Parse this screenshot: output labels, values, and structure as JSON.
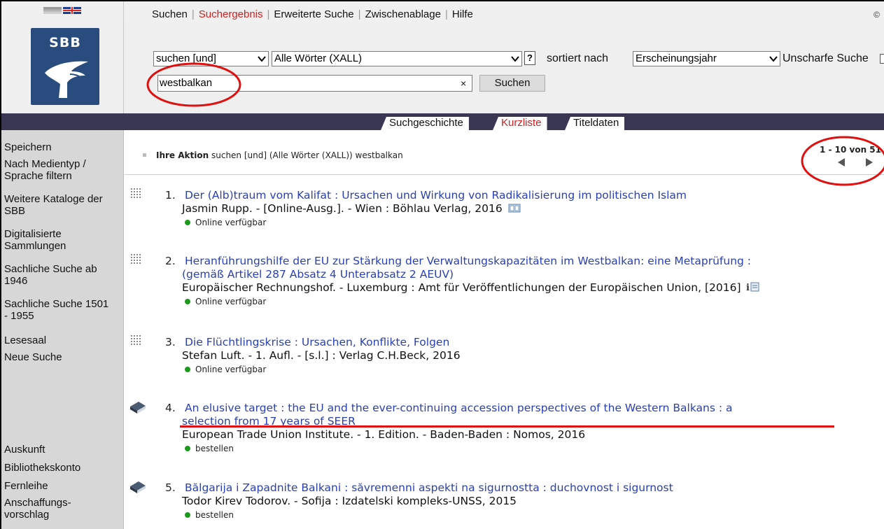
{
  "topnav": {
    "items": [
      {
        "label": "Suchen",
        "active": false
      },
      {
        "label": "Suchergebnis",
        "active": true
      },
      {
        "label": "Erweiterte Suche",
        "active": false
      },
      {
        "label": "Zwischenablage",
        "active": false
      },
      {
        "label": "Hilfe",
        "active": false
      }
    ],
    "copyright": "©"
  },
  "logo": {
    "text": "SBB"
  },
  "search": {
    "operator": "suchen [und]",
    "field": "Alle Wörter (XALL)",
    "help": "?",
    "sort_label": "sortiert nach",
    "sort_value": "Erscheinungsjahr",
    "fuzzy_label": "Unscharfe Suche",
    "query": "westbalkan",
    "clear": "×",
    "button": "Suchen"
  },
  "tabs": [
    {
      "label": "Suchgeschichte",
      "active": false
    },
    {
      "label": "Kurzliste",
      "active": true
    },
    {
      "label": "Titeldaten",
      "active": false
    }
  ],
  "sidebar": {
    "items": [
      "Speichern",
      "Nach Medientyp / Sprache filtern",
      "Weitere Kataloge der SBB",
      "Digitalisierte Sammlungen",
      "Sachliche Suche ab 1946",
      "Sachliche Suche 1501 - 1955",
      "Lesesaal",
      "Neue Suche"
    ],
    "bottom_items": [
      "Auskunft",
      "Bibliothekskonto",
      "Fernleihe",
      "Anschaffungs- vorschlag"
    ]
  },
  "action": {
    "label": "Ihre Aktion",
    "text": "suchen [und] (Alle Wörter (XALL)) westbalkan"
  },
  "paging": {
    "range": "1 - 10 von 51"
  },
  "records": [
    {
      "num": "1.",
      "title_lines": [
        "Der (Alb)traum vom Kalifat : Ursachen und Wirkung von Radikalisierung im politischen Islam"
      ],
      "author": "Jasmin Rupp. - [Online-Ausg.]. - Wien : Böhlau Verlag, 2016",
      "status": "Online verfügbar",
      "icon": "online-resource-icon"
    },
    {
      "num": "2.",
      "title_lines": [
        "Heranführungshilfe der EU zur Stärkung der Verwaltungskapazitäten im Westbalkan: eine Metaprüfung :",
        "(gemäß Artikel 287 Absatz 4 Unterabsatz 2 AEUV)"
      ],
      "author": "Europäischer Rechnungshof. - Luxemburg : Amt für Veröffentlichungen der Europäischen Union, [2016]",
      "status": "Online verfügbar",
      "icon": "online-resource-icon"
    },
    {
      "num": "3.",
      "title_lines": [
        "Die Flüchtlingskrise : Ursachen, Konflikte, Folgen"
      ],
      "author": "Stefan Luft. - 1. Aufl. - [s.l.] : Verlag C.H.Beck, 2016",
      "status": "Online verfügbar",
      "icon": "online-resource-icon"
    },
    {
      "num": "4.",
      "title_lines": [
        "An elusive target : the EU and the ever-continuing accession perspectives of the Western Balkans : a",
        "selection from 17 years of SEER"
      ],
      "author": "European Trade Union Institute. - 1. Edition. - Baden-Baden : Nomos, 2016",
      "status": "bestellen",
      "icon": "book-icon"
    },
    {
      "num": "5.",
      "title_lines": [
        "Bălgarija i Zapadnite Balkani : săvremenni aspekti na sigurnostta : duchovnost i sigurnost"
      ],
      "author": "Todor Kirev Todorov. - Sofija : Izdatelski kompleks-UNSS, 2015",
      "status": "bestellen",
      "icon": "book-icon"
    }
  ],
  "colors": {
    "link": "#2a3fb4",
    "active": "#d21f1f",
    "nav_band": "#3a3753",
    "logo": "#2a4b7d",
    "available": "#1d9a1d",
    "annotation": "#e01010"
  }
}
